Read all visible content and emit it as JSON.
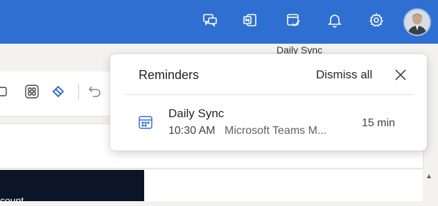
{
  "colors": {
    "header_bg": "#2f6fd1",
    "card_bg": "#ffffff",
    "accent": "#2f6fd1",
    "text_primary": "#242424"
  },
  "header": {
    "icons": [
      "chat-icon",
      "onenote-icon",
      "my-day-icon",
      "bell-icon",
      "gear-icon"
    ],
    "avatar": "user-avatar"
  },
  "tooltip": {
    "text": "Daily Sync"
  },
  "background": {
    "dark_panel_text": "count"
  },
  "reminders": {
    "title": "Reminders",
    "dismiss_all_label": "Dismiss all",
    "items": [
      {
        "subject": "Daily Sync",
        "time": "10:30 AM",
        "location": "Microsoft Teams M...",
        "due": "15 min",
        "icon": "calendar-icon"
      }
    ]
  }
}
